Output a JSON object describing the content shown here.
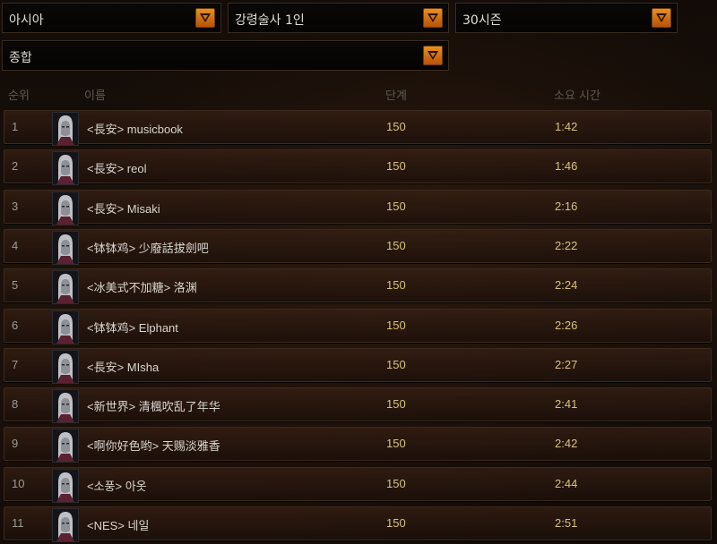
{
  "filters": {
    "region": "아시아",
    "hero_class": "강령술사 1인",
    "season": "30시즌",
    "category": "종합"
  },
  "table": {
    "headers": {
      "rank": "순위",
      "name": "이름",
      "stage": "단계",
      "time": "소요 시간"
    },
    "rows": [
      {
        "rank": "1",
        "name": "<長安> musicbook",
        "stage": "150",
        "time": "1:42"
      },
      {
        "rank": "2",
        "name": "<長安> reol",
        "stage": "150",
        "time": "1:46"
      },
      {
        "rank": "3",
        "name": "<長安> Misaki",
        "stage": "150",
        "time": "2:16"
      },
      {
        "rank": "4",
        "name": "<钵钵鸡> 少廢話拔劍吧",
        "stage": "150",
        "time": "2:22"
      },
      {
        "rank": "5",
        "name": "<冰美式不加糖> 洛渊",
        "stage": "150",
        "time": "2:24"
      },
      {
        "rank": "6",
        "name": "<钵钵鸡> Elphant",
        "stage": "150",
        "time": "2:26"
      },
      {
        "rank": "7",
        "name": "<長安> MIsha",
        "stage": "150",
        "time": "2:27"
      },
      {
        "rank": "8",
        "name": "<新世界> 清楓吹乱了年华",
        "stage": "150",
        "time": "2:41"
      },
      {
        "rank": "9",
        "name": "<啊你好色哟> 天赐淡雅香",
        "stage": "150",
        "time": "2:42"
      },
      {
        "rank": "10",
        "name": "<소풍> 아옷",
        "stage": "150",
        "time": "2:44"
      },
      {
        "rank": "11",
        "name": "<NES> 네일",
        "stage": "150",
        "time": "2:51"
      }
    ]
  },
  "icons": {
    "dropdown_arrow": "chevron-down-icon",
    "portrait": "necromancer-portrait-icon"
  },
  "colors": {
    "arrow_orange": "#e08a1c",
    "value_gold": "#d8c27a",
    "header_gray": "#5d5a55"
  }
}
